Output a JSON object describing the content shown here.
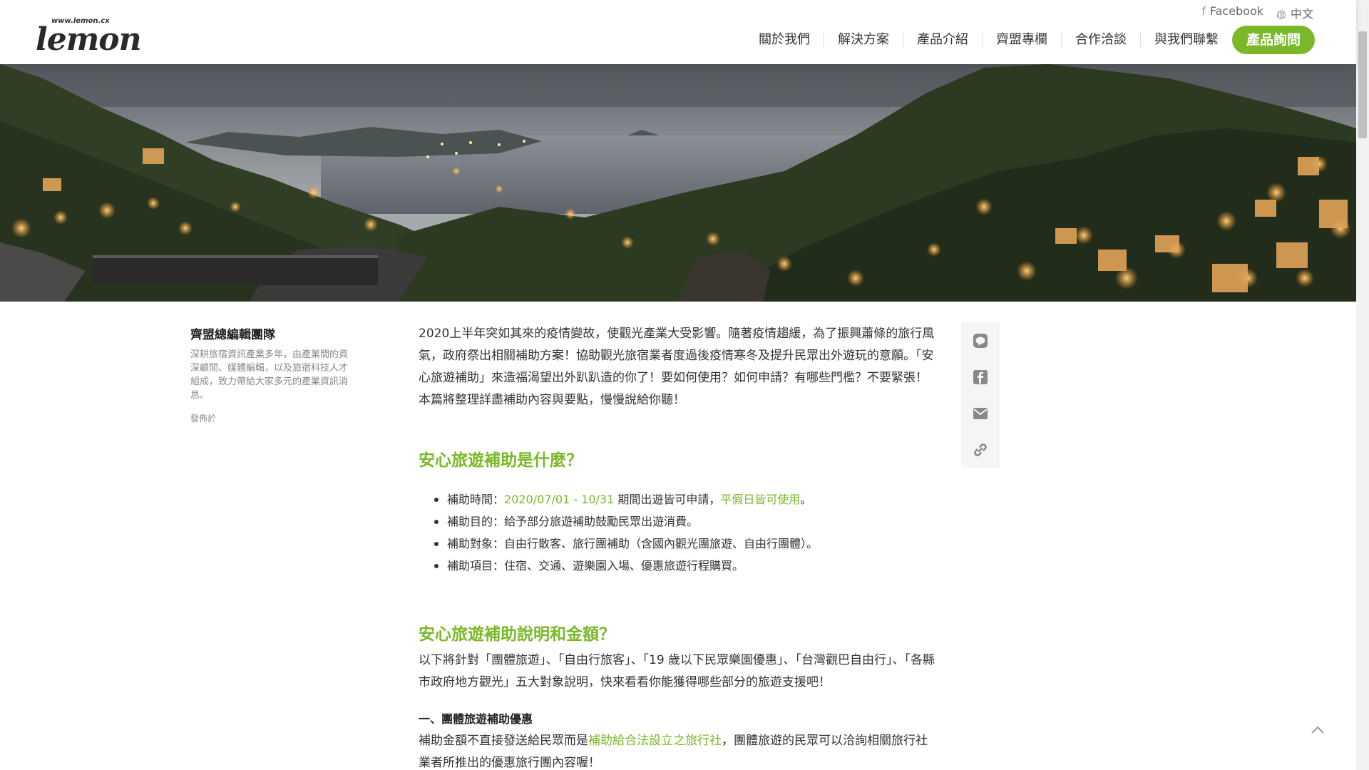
{
  "header": {
    "logo_url_text": "www.lemon.cx",
    "logo_text": "lemon",
    "top_links": [
      {
        "icon": "facebook-icon",
        "label": "Facebook"
      },
      {
        "icon": "globe-icon",
        "label": "中文"
      }
    ],
    "nav": [
      "關於我們",
      "解決方案",
      "產品介紹",
      "齊盟專欄",
      "合作洽談",
      "與我們聯繫"
    ],
    "cta": "產品詢問"
  },
  "hero": {
    "description": "mountain village at dusk overlooking the sea"
  },
  "author": {
    "name": "齊盟總編輯團隊",
    "description": "深耕旅宿資訊產業多年，由產業間的資深顧問、媒體編輯，以及旅宿科技人才組成，致力帶給大家多元的產業資訊消息。",
    "meta": "發佈於"
  },
  "article": {
    "intro": "2020上半年突如其來的疫情變故，使觀光產業大受影響。隨著疫情趨緩，為了振興蕭條的旅行風氣，政府祭出相關補助方案！協助觀光旅宿業者度過後疫情寒冬及提升民眾出外遊玩的意願。「安心旅遊補助」來造福渴望出外趴趴造的你了！要如何使用？如何申請？有哪些門檻？不要緊張！本篇將整理詳盡補助內容與要點，慢慢說給你聽！",
    "section1_title": "安心旅遊補助是什麼？",
    "bullets": {
      "b1_prefix": "補助時間：",
      "b1_date": "2020/07/01 - 10/31",
      "b1_mid": " 期間出遊皆可申請，",
      "b1_link": "平假日皆可使用",
      "b1_end": "。",
      "b2": "補助目的：給予部分旅遊補助鼓勵民眾出遊消費。",
      "b3": "補助對象：自由行散客、旅行團補助（含國內觀光團旅遊、自由行團體）。",
      "b4": "補助項目：住宿、交通、遊樂園入場、優惠旅遊行程購買。"
    },
    "section2_title": "安心旅遊補助說明和金額？",
    "section2_body": "以下將針對「團體旅遊」、「自由行旅客」、「19 歲以下民眾樂園優惠」、「台灣觀巴自由行」、「各縣市政府地方觀光」五大對象說明，快來看看你能獲得哪些部分的旅遊支援吧！",
    "sub1_title": "一、團體旅遊補助優惠",
    "sub1_prefix": "補助金額不直接發送給民眾而是",
    "sub1_link": "補助給合法設立之旅行社",
    "sub1_suffix": "，團體旅遊的民眾可以洽詢相關旅行社業者所推出的優惠旅行團內容喔！"
  },
  "share": [
    "line-icon",
    "facebook-square-icon",
    "envelope-icon",
    "link-icon"
  ],
  "colors": {
    "accent": "#7ab829",
    "text": "#333333"
  }
}
